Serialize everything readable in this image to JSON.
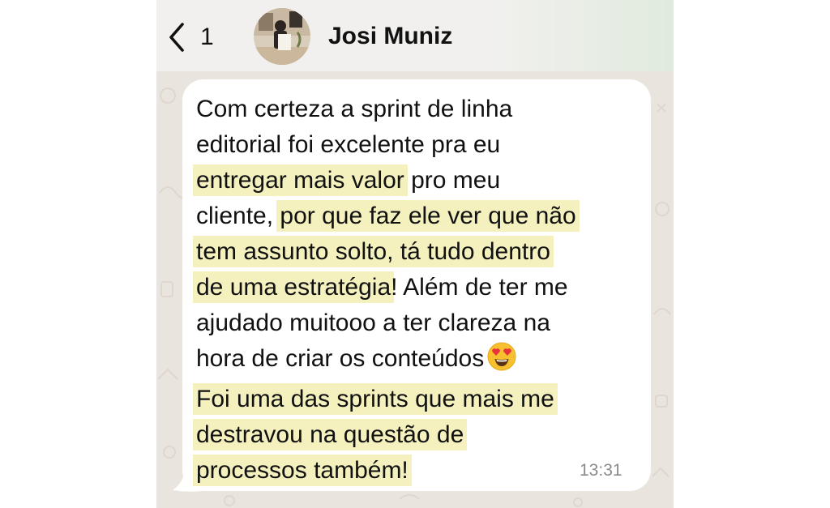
{
  "header": {
    "back_count": "1",
    "contact_name": "Josi Muniz",
    "avatar_icon": "contact-photo"
  },
  "message": {
    "lines": [
      {
        "plain": "Com certeza a sprint de linha"
      },
      {
        "plain": "editorial foi excelente pra eu"
      },
      {
        "highlight": "entregar mais valor",
        "plain_after": " pro meu"
      },
      {
        "plain": "cliente, ",
        "highlight": "por que faz ele ver que não"
      },
      {
        "highlight": "tem assunto solto, tá tudo dentro"
      },
      {
        "highlight": "de uma estratégia",
        "plain_after": "! Além de ter me"
      },
      {
        "plain": "ajudado muitooo a ter clareza na"
      },
      {
        "plain": "hora de criar os conteúdos"
      },
      {
        "highlight": "Foi uma das sprints que mais me"
      },
      {
        "highlight": "destravou na questão de"
      },
      {
        "highlight": "processos também!"
      }
    ],
    "emoji": "heart-eyes-emoji",
    "time": "13:31"
  },
  "colors": {
    "highlight": "#f4f1bf",
    "bubble": "#ffffff",
    "chat_background": "#e9e4dd",
    "header": "#f1f0ee",
    "text": "#111111",
    "timestamp": "#8a8a8a"
  }
}
